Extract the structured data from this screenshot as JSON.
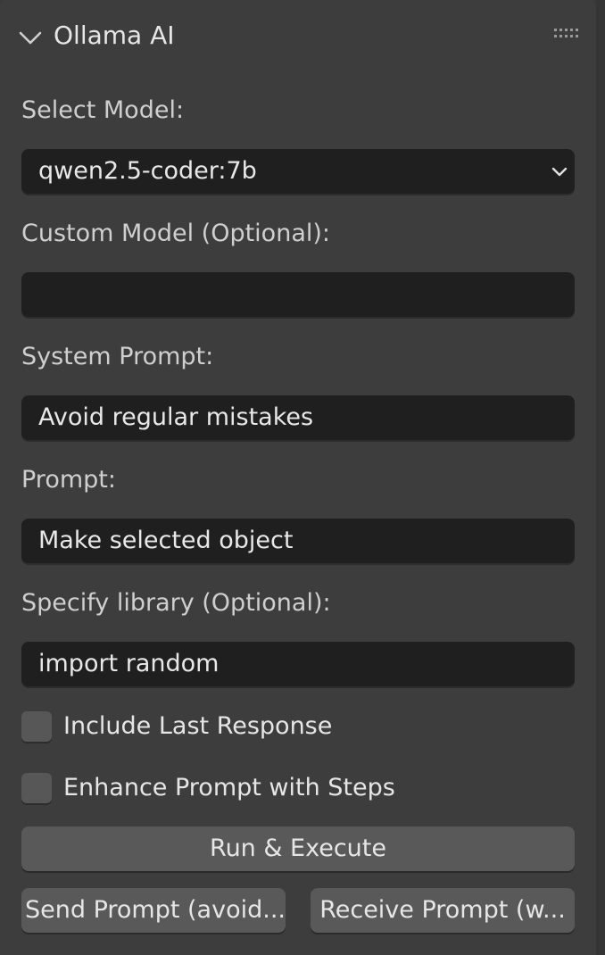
{
  "panel": {
    "title": "Ollama AI",
    "collapse_icon": "chevron-down-icon",
    "drag_icon": "drag-handle-icon"
  },
  "model": {
    "label": "Select Model:",
    "value": "qwen2.5-coder:7b"
  },
  "custom_model": {
    "label": "Custom Model (Optional):",
    "value": ""
  },
  "system_prompt": {
    "label": "System Prompt:",
    "value": "Avoid regular mistakes"
  },
  "prompt": {
    "label": "Prompt:",
    "value": "Make selected object"
  },
  "library": {
    "label": "Specify library (Optional):",
    "value": "import random"
  },
  "options": {
    "include_last_response": {
      "label": "Include Last Response",
      "checked": false
    },
    "enhance_prompt": {
      "label": "Enhance Prompt with Steps",
      "checked": false
    }
  },
  "buttons": {
    "run_execute": "Run & Execute",
    "send_prompt": "Send Prompt (avoid...",
    "receive_prompt": "Receive Prompt (w..."
  },
  "colors": {
    "panel_bg": "#3d3d3d",
    "field_bg": "#1f1f1f",
    "button_bg": "#595959",
    "text": "#e6e6e6"
  }
}
